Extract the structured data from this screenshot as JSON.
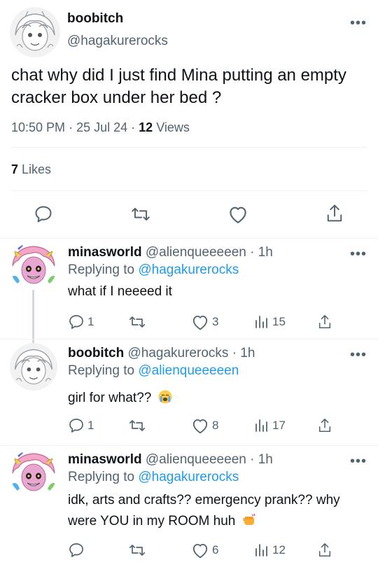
{
  "main_tweet": {
    "display_name": "boobitch",
    "handle": "@hagakurerocks",
    "text": "chat why did I just find Mina putting an empty cracker box under her bed ?",
    "time": "10:50 PM",
    "date": "25 Jul 24",
    "separator": "·",
    "views_count": "12",
    "views_label": "Views",
    "likes_count": "7",
    "likes_label": "Likes",
    "more_icon": "more-dots-icon"
  },
  "replies": [
    {
      "display_name": "minasworld",
      "handle": "@alienqueeeeen",
      "time": "· 1h",
      "replying_label": "Replying to",
      "replying_to": "@hagakurerocks",
      "text": "what if I neeeed it",
      "reply_count": "1",
      "retweet_count": "",
      "like_count": "3",
      "view_count": "15"
    },
    {
      "display_name": "boobitch",
      "handle": "@hagakurerocks",
      "time": "· 1h",
      "replying_label": "Replying to",
      "replying_to": "@alienqueeeeen",
      "text": "girl for what??",
      "emoji": "loudly-crying-face",
      "reply_count": "1",
      "retweet_count": "",
      "like_count": "8",
      "view_count": "17"
    },
    {
      "display_name": "minasworld",
      "handle": "@alienqueeeeen",
      "time": "· 1h",
      "replying_label": "Replying to",
      "replying_to": "@hagakurerocks",
      "text": "idk, arts and crafts?? emergency prank?? why were YOU in my ROOM huh",
      "emoji": "angry-fist",
      "reply_count": "",
      "retweet_count": "",
      "like_count": "6",
      "view_count": "12"
    }
  ],
  "colors": {
    "text": "#0f1419",
    "secondary": "#536471",
    "link": "#1d9bf0",
    "divider": "#eff3f4",
    "thread_line": "#cfd9de"
  }
}
